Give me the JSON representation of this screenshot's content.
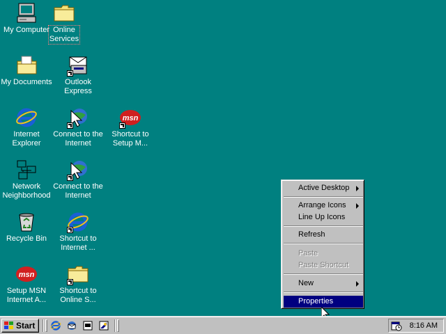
{
  "desktop": {
    "icons": [
      {
        "name": "my-computer",
        "label": "My Computer"
      },
      {
        "name": "online-services",
        "label": "Online\nServices"
      },
      {
        "name": "my-documents",
        "label": "My Documents"
      },
      {
        "name": "outlook-express",
        "label": "Outlook\nExpress"
      },
      {
        "name": "internet-explorer",
        "label": "Internet\nExplorer"
      },
      {
        "name": "connect-to-internet-1",
        "label": "Connect to the\nInternet"
      },
      {
        "name": "shortcut-setup-msn-1",
        "label": "Shortcut to\nSetup M..."
      },
      {
        "name": "network-neighborhood",
        "label": "Network\nNeighborhood"
      },
      {
        "name": "connect-to-internet-2",
        "label": "Connect to the\nInternet"
      },
      {
        "name": "recycle-bin",
        "label": "Recycle Bin"
      },
      {
        "name": "shortcut-internet",
        "label": "Shortcut to\nInternet ..."
      },
      {
        "name": "setup-msn",
        "label": "Setup MSN\nInternet A..."
      },
      {
        "name": "shortcut-online-services",
        "label": "Shortcut to\nOnline S..."
      }
    ]
  },
  "context_menu": {
    "items": [
      {
        "label": "Active Desktop",
        "submenu": true
      },
      {
        "label": "Arrange Icons",
        "submenu": true
      },
      {
        "label": "Line Up Icons"
      },
      {
        "label": "Refresh"
      },
      {
        "label": "Paste",
        "disabled": true
      },
      {
        "label": "Paste Shortcut",
        "disabled": true
      },
      {
        "label": "New",
        "submenu": true
      },
      {
        "label": "Properties",
        "highlighted": true
      }
    ]
  },
  "taskbar": {
    "start_label": "Start",
    "clock": "8:16 AM",
    "quick_launch": [
      "internet-explorer-icon",
      "outlook-express-icon",
      "show-desktop-icon",
      "view-channels-icon"
    ]
  },
  "colors": {
    "desktop": "#008080",
    "face": "#c0c0c0",
    "highlight": "#000080"
  }
}
